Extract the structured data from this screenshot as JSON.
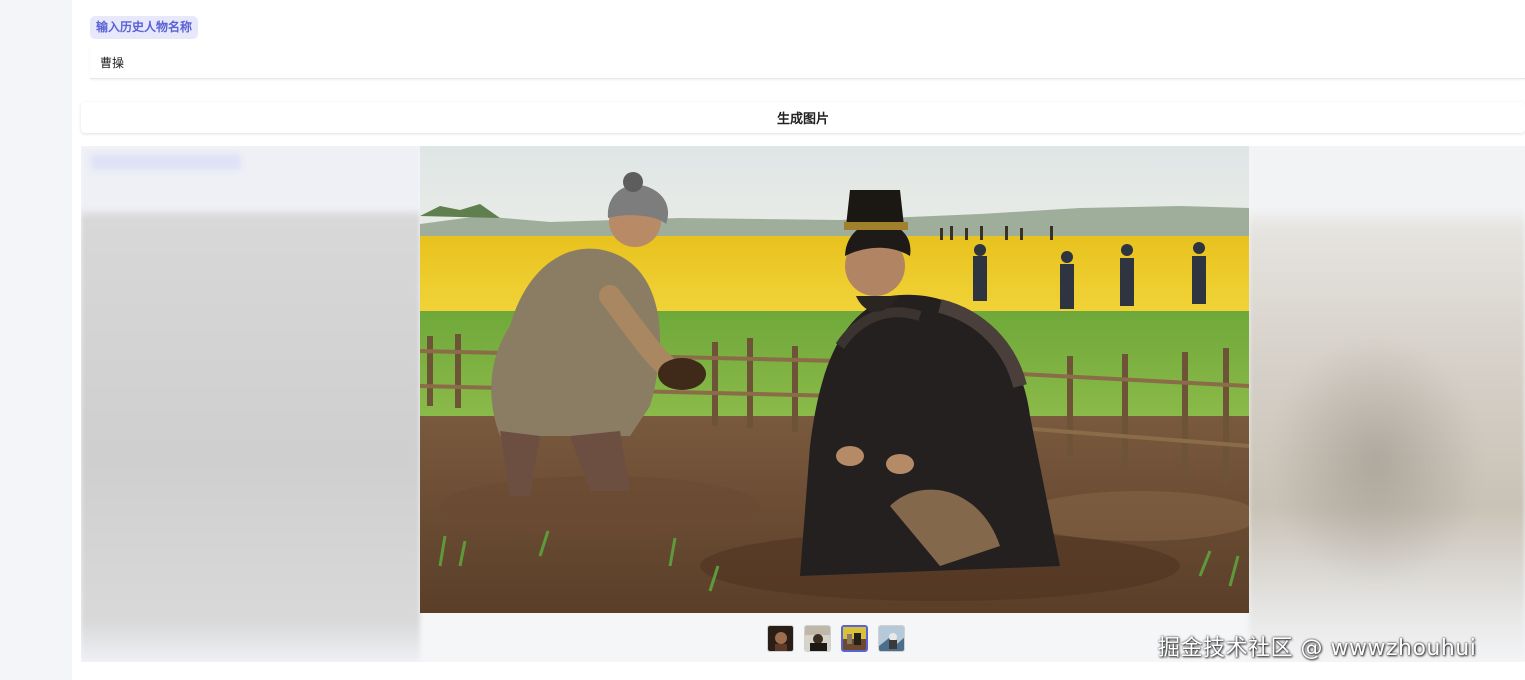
{
  "form": {
    "label": "输入历史人物名称",
    "input_value": "曹操"
  },
  "actions": {
    "generate_label": "生成图片"
  },
  "gallery": {
    "thumbnail_count": 4,
    "selected_index": 2
  },
  "watermark": "掘金技术社区 @ wwwzhouhui",
  "colors": {
    "accent": "#5a62d6",
    "label_bg": "#e7e9fb",
    "page_bg": "#f4f6f9"
  }
}
